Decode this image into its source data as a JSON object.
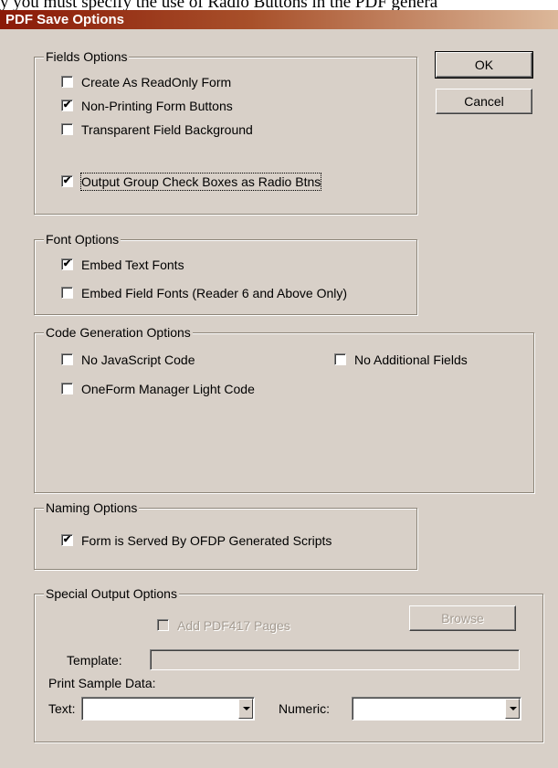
{
  "background_text": "y you must specify the use of Radio Buttons in the PDF genera",
  "dialog": {
    "title": "PDF Save Options",
    "ok_label": "OK",
    "cancel_label": "Cancel"
  },
  "fields_options": {
    "legend": "Fields Options",
    "items": [
      {
        "label": "Create As ReadOnly Form",
        "checked": false
      },
      {
        "label": "Non-Printing Form Buttons",
        "checked": true
      },
      {
        "label": "Transparent Field Background",
        "checked": false
      },
      {
        "label": "Output Group Check Boxes as Radio Btns",
        "checked": true
      }
    ]
  },
  "font_options": {
    "legend": "Font Options",
    "items": [
      {
        "label": "Embed Text Fonts",
        "checked": true
      },
      {
        "label": "Embed Field Fonts (Reader 6 and Above Only)",
        "checked": false
      }
    ]
  },
  "code_generation_options": {
    "legend": "Code Generation Options",
    "items": [
      {
        "label": "No JavaScript Code",
        "checked": false
      },
      {
        "label": "No Additional Fields",
        "checked": false
      },
      {
        "label": "OneForm Manager Light Code",
        "checked": false
      }
    ]
  },
  "naming_options": {
    "legend": "Naming Options",
    "items": [
      {
        "label": "Form is Served By OFDP Generated Scripts",
        "checked": true
      }
    ]
  },
  "special_output_options": {
    "legend": "Special Output Options",
    "add_pdf417_label": "Add PDF417 Pages",
    "add_pdf417_checked": false,
    "browse_label": "Browse",
    "template_label": "Template:",
    "template_value": "",
    "print_sample_label": "Print Sample Data:",
    "text_label": "Text:",
    "text_value": "",
    "numeric_label": "Numeric:",
    "numeric_value": ""
  },
  "check_mark": "✔"
}
